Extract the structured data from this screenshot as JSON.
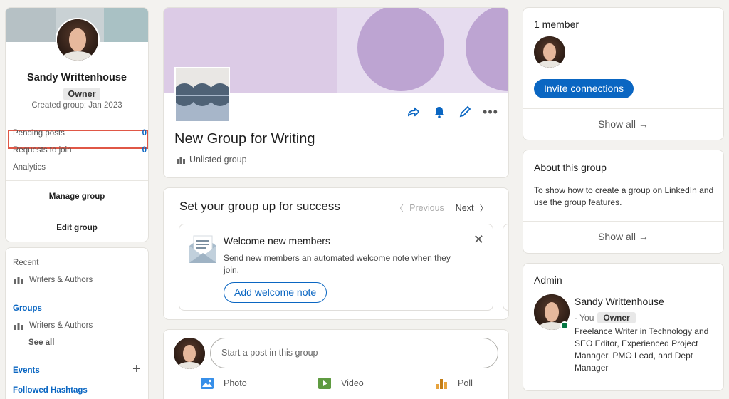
{
  "profile": {
    "name": "Sandy Writtenhouse",
    "role_badge": "Owner",
    "created": "Created group: Jan 2023",
    "stats": [
      {
        "label": "Pending posts",
        "value": "0"
      },
      {
        "label": "Requests to join",
        "value": "0"
      },
      {
        "label": "Analytics",
        "value": ""
      }
    ],
    "manage_label": "Manage group",
    "edit_label": "Edit group"
  },
  "nav": {
    "recent_label": "Recent",
    "recent_items": [
      "Writers & Authors"
    ],
    "groups_label": "Groups",
    "group_items": [
      "Writers & Authors"
    ],
    "see_all": "See all",
    "events_label": "Events",
    "hashtags_label": "Followed Hashtags"
  },
  "group": {
    "title": "New Group for Writing",
    "visibility": "Unlisted group"
  },
  "success": {
    "title": "Set your group up for success",
    "previous": "Previous",
    "next": "Next",
    "item_title": "Welcome new members",
    "item_desc": "Send new members an automated welcome note when they join.",
    "item_button": "Add welcome note"
  },
  "post": {
    "placeholder": "Start a post in this group",
    "actions": [
      "Photo",
      "Video",
      "Poll"
    ]
  },
  "members": {
    "count_label": "1 member",
    "invite_label": "Invite connections",
    "show_all": "Show all →"
  },
  "about": {
    "title": "About this group",
    "text": "To show how to create a group on LinkedIn and use the group features.",
    "show_all": "Show all →"
  },
  "admin": {
    "title": "Admin",
    "name": "Sandy Writtenhouse",
    "you": "· You",
    "badge": "Owner",
    "bio": "Freelance Writer in Technology and SEO Editor, Experienced Project Manager, PMO Lead, and Dept Manager"
  },
  "colors": {
    "accent": "#0a66c2",
    "highlight_box": "#e05746",
    "banner": "#dccbe6",
    "online": "#057642"
  }
}
